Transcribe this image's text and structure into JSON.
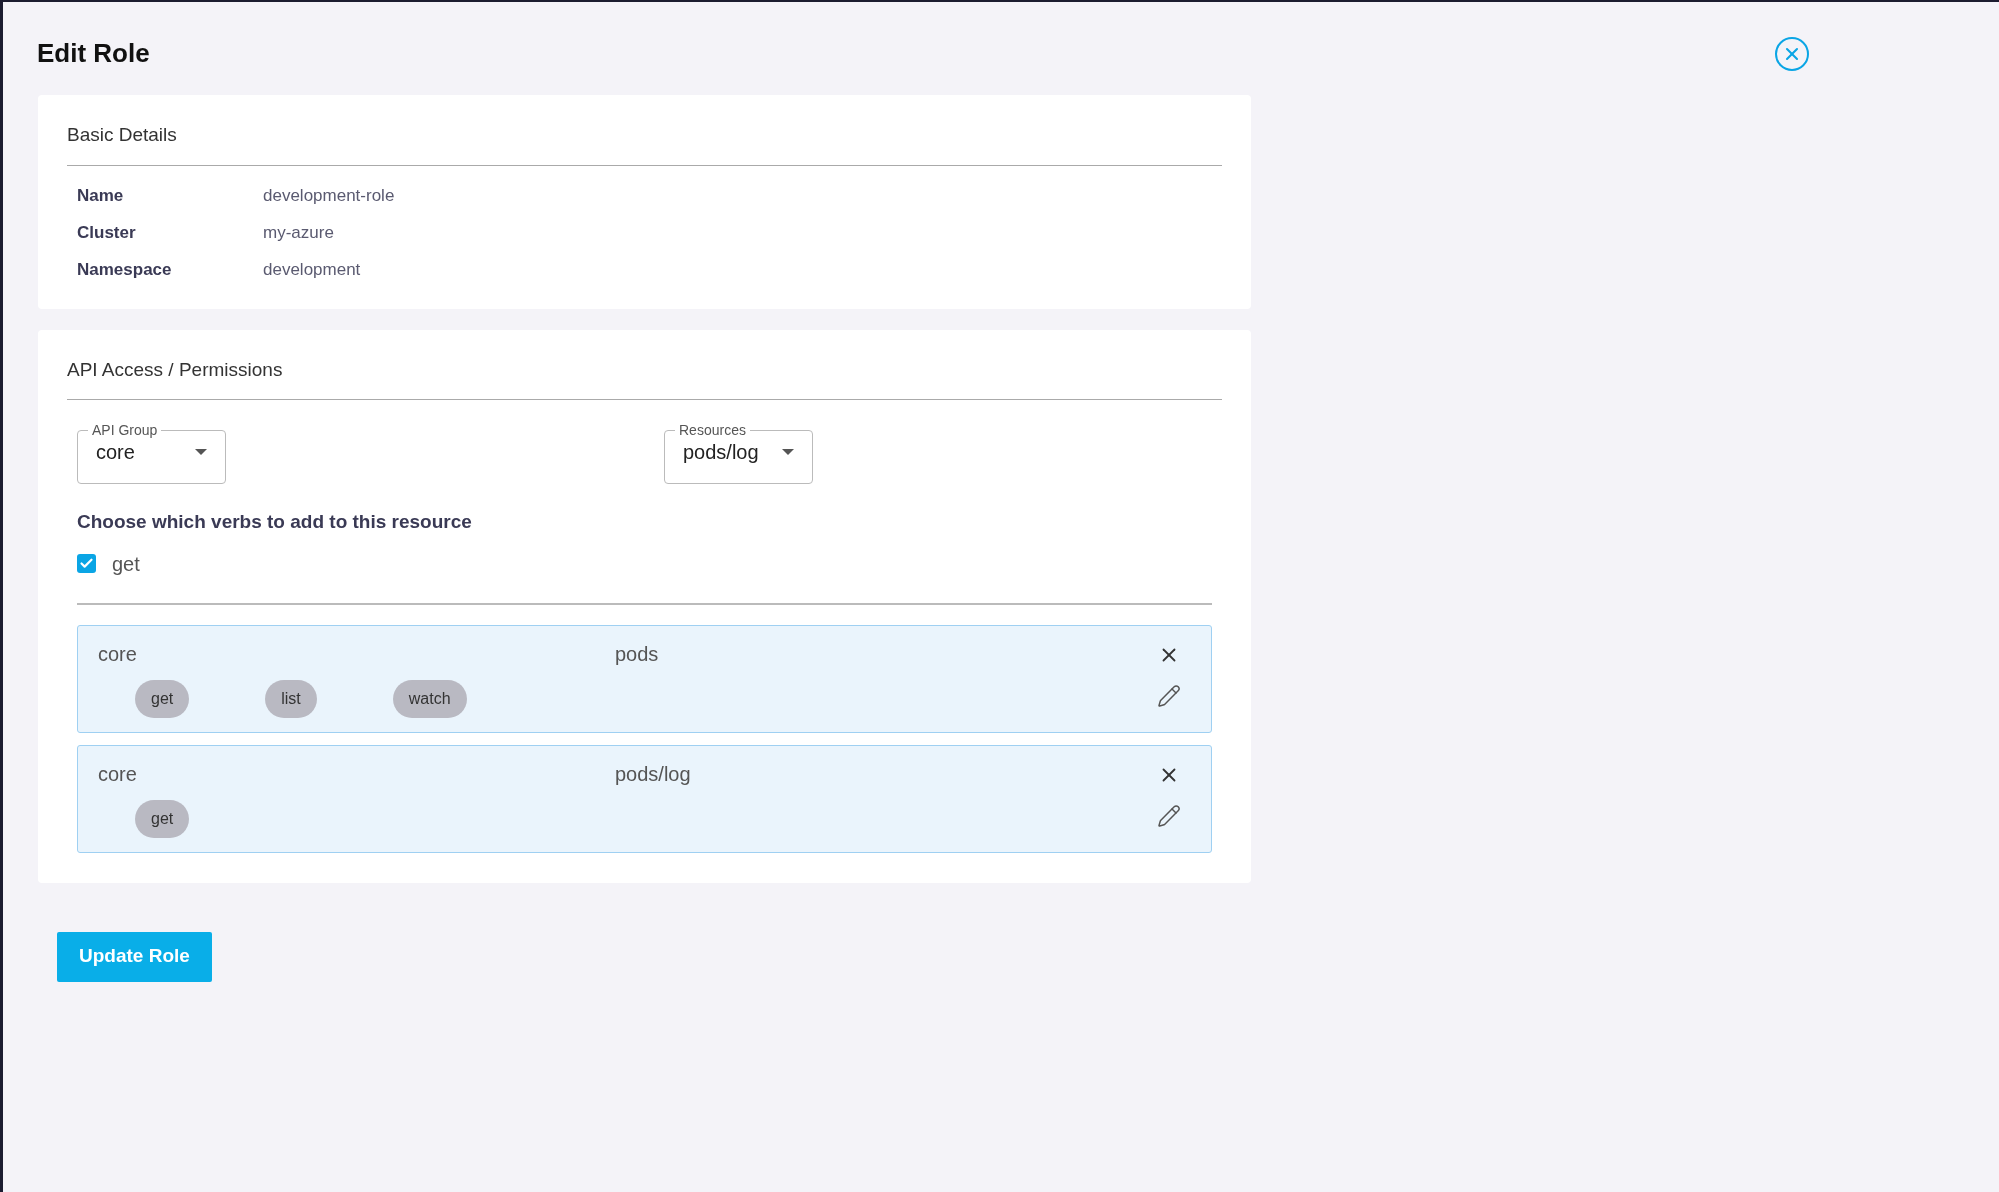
{
  "title": "Edit Role",
  "basic_details": {
    "heading": "Basic Details",
    "fields": [
      {
        "label": "Name",
        "value": "development-role"
      },
      {
        "label": "Cluster",
        "value": "my-azure"
      },
      {
        "label": "Namespace",
        "value": "development"
      }
    ]
  },
  "permissions": {
    "heading": "API Access / Permissions",
    "selects": [
      {
        "label": "API Group",
        "value": "core"
      },
      {
        "label": "Resources",
        "value": "pods/log"
      }
    ],
    "verbs_heading": "Choose which verbs to add to this resource",
    "verbs": [
      {
        "label": "get",
        "checked": true
      }
    ],
    "rules": [
      {
        "api_group": "core",
        "resource": "pods",
        "verbs": [
          "get",
          "list",
          "watch"
        ]
      },
      {
        "api_group": "core",
        "resource": "pods/log",
        "verbs": [
          "get"
        ]
      }
    ]
  },
  "submit": "Update Role"
}
